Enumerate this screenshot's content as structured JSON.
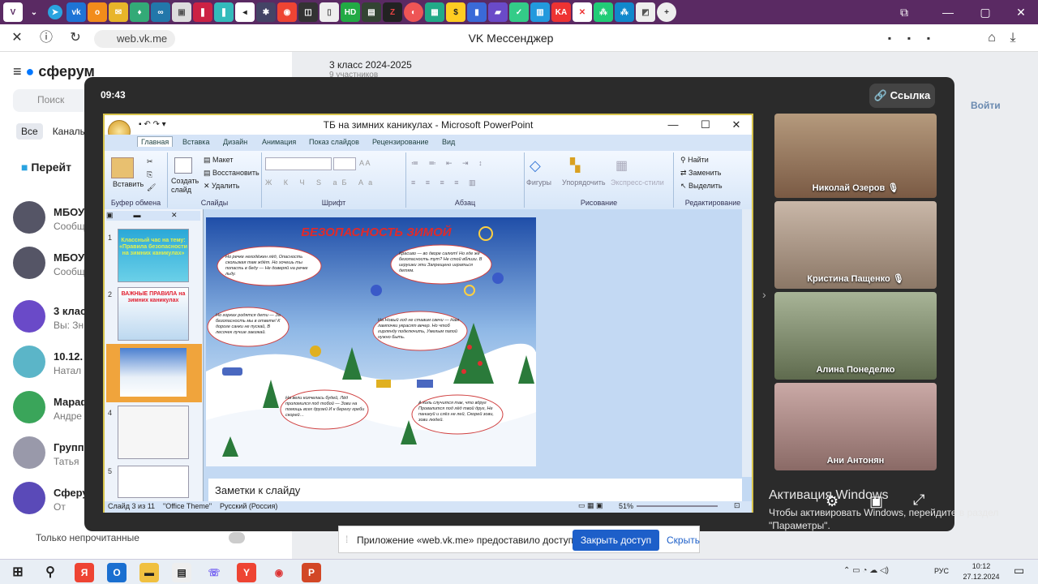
{
  "browser": {
    "tabs": [
      "vk-tab",
      "telegram",
      "vk",
      "ok",
      "mail",
      "app",
      "app2",
      "app3",
      "app4",
      "active",
      "app6",
      "app7",
      "app8",
      "app9",
      "hd",
      "app11",
      "z",
      "app13",
      "app14",
      "app15",
      "app16",
      "app17",
      "app18",
      "app19",
      "app20",
      "app21",
      "app22",
      "app23",
      "add"
    ],
    "url": "web.vk.me",
    "page_title": "VK Мессенджер"
  },
  "vk": {
    "brand": "сферум",
    "search_placeholder": "Поиск",
    "filters": [
      "Все",
      "Каналы"
    ],
    "go_item": "Перейт",
    "chat_header_title": "3 класс 2024-2025",
    "chat_header_sub": "9 участников",
    "join_label": "Войти",
    "chats": [
      {
        "name": "МБОУ",
        "sub": "Сообщ"
      },
      {
        "name": "МБОУ",
        "sub": "Сообщ"
      },
      {
        "name": "3 клас",
        "sub": "Вы: Зн"
      },
      {
        "name": "10.12.",
        "sub": "Натал"
      },
      {
        "name": "Мараф",
        "sub": "Андре"
      },
      {
        "name": "Группо",
        "sub": "Татья"
      },
      {
        "name": "Сферу",
        "sub": "От"
      }
    ],
    "unread_only": "Только непрочитанные"
  },
  "call": {
    "timer": "09:43",
    "link_button": "Ссылка",
    "participants": [
      "Николай Озеров",
      "Кристина Пащенко",
      "Алина Понеделко",
      "Ани Антонян"
    ]
  },
  "ppt": {
    "title": "ТБ на зимних каникулах - Microsoft PowerPoint",
    "tabs": [
      "Главная",
      "Вставка",
      "Дизайн",
      "Анимация",
      "Показ слайдов",
      "Рецензирование",
      "Вид"
    ],
    "groups": [
      "Буфер обмена",
      "Слайды",
      "Шрифт",
      "Абзац",
      "Рисование",
      "Редактирование"
    ],
    "clipboard": {
      "paste": "Вставить"
    },
    "slides_group": {
      "create": "Создать слайд",
      "layout": "Макет",
      "restore": "Восстановить",
      "delete": "Удалить"
    },
    "drawing": {
      "shapes": "Фигуры",
      "arrange": "Упорядочить",
      "quick_styles": "Экспресс-стили"
    },
    "editing": {
      "find": "Найти",
      "replace": "Заменить",
      "select": "Выделить"
    },
    "slide_numbers": [
      "1",
      "2",
      "3",
      "4",
      "5"
    ],
    "thumb1_text": "Классный час на тему: «Правила безопасности на зимних каникулах»",
    "thumb2_text": "ВАЖНЫЕ ПРАВИЛА на зимних каникулах",
    "slide_title": "БЕЗОПАСНОСТЬ ЗИМОЙ",
    "bubbles": [
      "Но речке неходёжен лёд, Опасность скользкая там ждёт. Но хочешь ты попасть в беду — Не доверяй на речке льду.",
      "Красиво — во дворе салют! Но где же безопасность тут? Не стой вблизи. В игрушки эти Запрещено играться детям.",
      "Но горках родятся дети — За безопасность мы в ответе! К дороге санки не пускай, В лесочек лучше заезжай.",
      "На Новый год не ставим свечи — Нам лампочки украсят вечер. Но чтоб гирлянду подключить, Умелым папой нужно быть.",
      "На вели колчелась будей, Лёд проломился под тобой — Зови на помощь всех друзей И к берегу греби скорей…",
      "А коль случится так, что вдруг Провалится под лёд твой друг, Не паникуй и слёз не лей, Скорей зови, зови людей."
    ],
    "notes": "Заметки к слайду",
    "status": {
      "slide": "Слайд 3 из 11",
      "theme": "\"Office Theme\"",
      "lang": "Русский (Россия)",
      "zoom": "51%"
    }
  },
  "windows_activation": {
    "title": "Активация Windows",
    "text": "Чтобы активировать Windows, перейдите в раздел \"Параметры\"."
  },
  "notification": {
    "text": "Приложение «web.vk.me» предоставило доступ к окну.",
    "open_button": "Закрыть доступ",
    "hide": "Скрыть"
  },
  "taskbar": {
    "lang": "РУС",
    "time": "10:12",
    "date": "27.12.2024"
  }
}
